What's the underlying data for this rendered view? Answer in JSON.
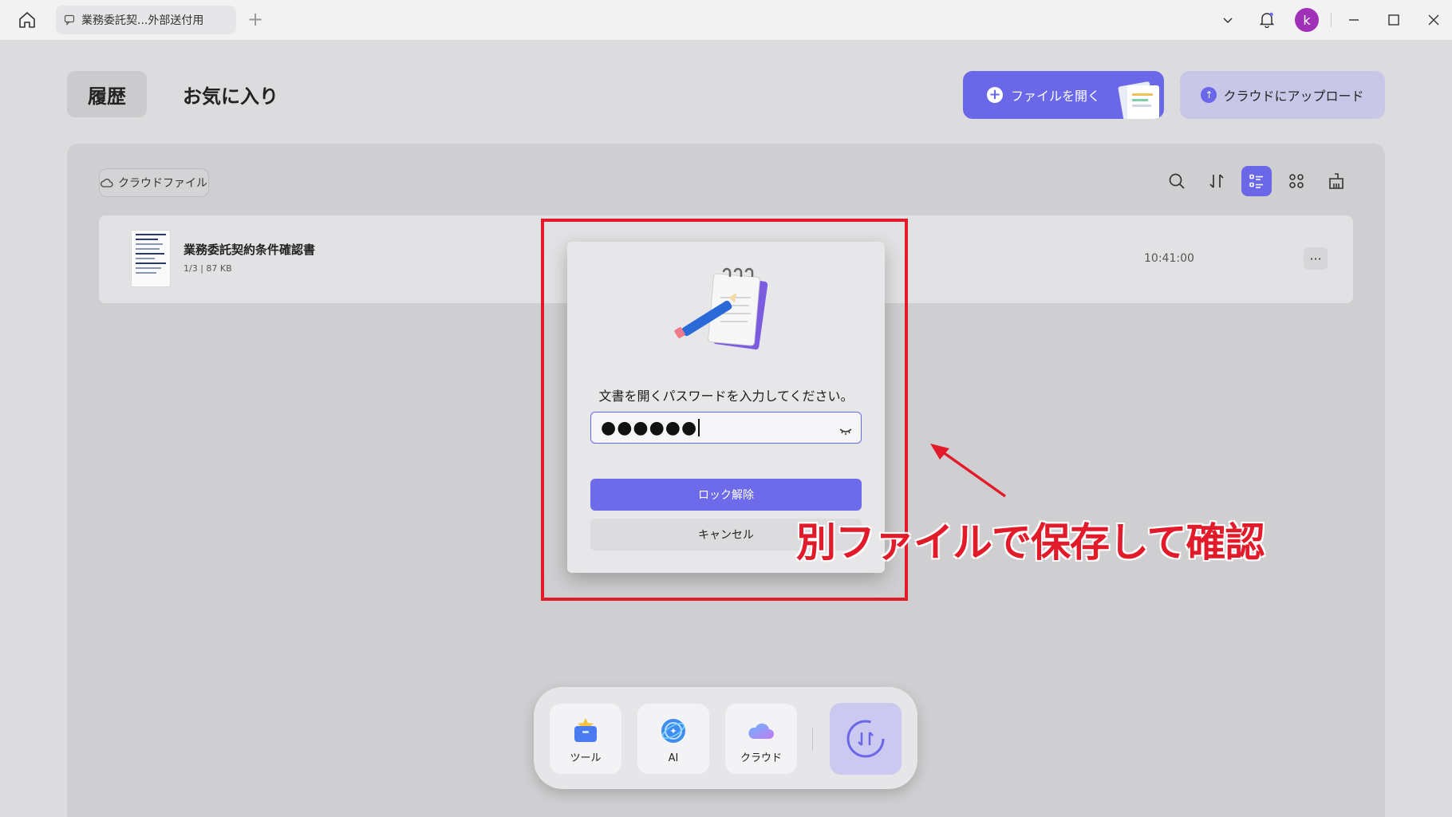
{
  "titlebar": {
    "tab_title": "業務委託契...外部送付用",
    "new_tab": "+",
    "avatar_letter": "k"
  },
  "nav": {
    "history": "履歴",
    "favorites": "お気に入り"
  },
  "actions": {
    "open_file": "ファイルを開く",
    "upload_cloud": "クラウドにアップロード"
  },
  "panel": {
    "cloud_chip": "クラウドファイル",
    "file": {
      "name": "業務委託契約条件確認書",
      "meta": "1/3 | 87 KB",
      "time": "10:41:00",
      "more": "···"
    }
  },
  "dialog": {
    "message": "文書を開くパスワードを入力してください。",
    "password_mask": "●●●●●●",
    "unlock_label": "ロック解除",
    "cancel_label": "キャンセル"
  },
  "annotation": {
    "text": "別ファイルで保存して確認",
    "color": "#e11b2a"
  },
  "dock": {
    "tools": "ツール",
    "ai": "AI",
    "cloud": "クラウド"
  },
  "colors": {
    "accent": "#6a68e9",
    "avatar": "#a030b8"
  }
}
